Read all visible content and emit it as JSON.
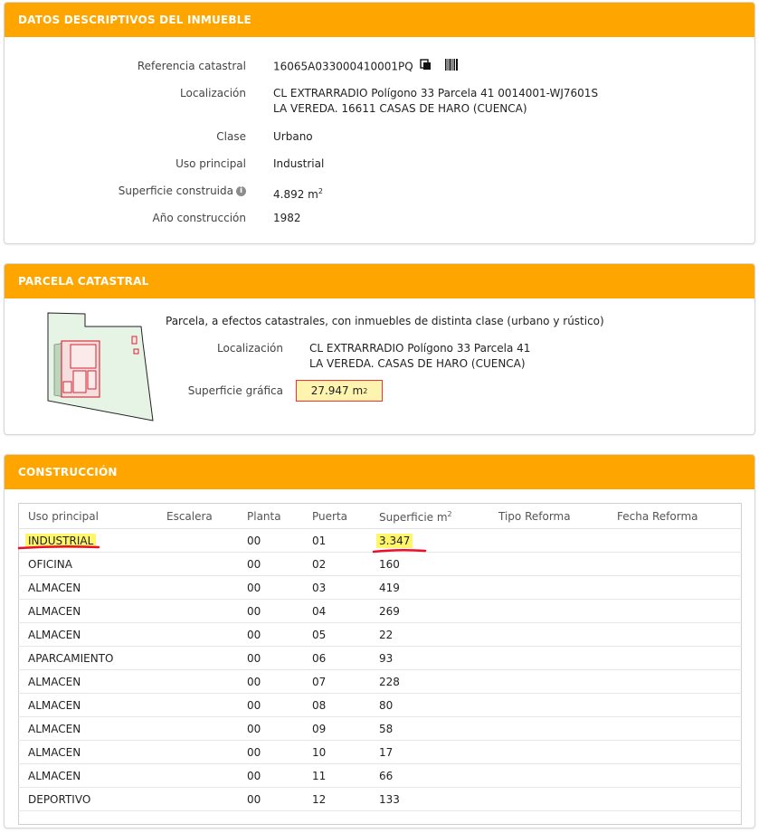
{
  "descriptivos": {
    "title": "DATOS DESCRIPTIVOS DEL INMUEBLE",
    "ref_label": "Referencia catastral",
    "ref_value": "16065A033000410001PQ",
    "loc_label": "Localización",
    "loc_line1": "CL EXTRARRADIO Polígono 33 Parcela 41 0014001-WJ7601S",
    "loc_line2": "LA VEREDA. 16611 CASAS DE HARO (CUENCA)",
    "clase_label": "Clase",
    "clase_value": "Urbano",
    "uso_label": "Uso principal",
    "uso_value": "Industrial",
    "sup_label": "Superficie construida",
    "sup_value": "4.892 m",
    "sup_unit_sup": "2",
    "anio_label": "Año construcción",
    "anio_value": "1982"
  },
  "parcela": {
    "title": "PARCELA CATASTRAL",
    "desc": "Parcela, a efectos catastrales, con inmuebles de distinta clase (urbano y rústico)",
    "loc_label": "Localización",
    "loc_line1": "CL EXTRARRADIO Polígono 33 Parcela 41",
    "loc_line2": "LA VEREDA. CASAS DE HARO (CUENCA)",
    "sup_label": "Superficie gráfica",
    "sup_value": "27.947 m",
    "sup_unit_sup": "2"
  },
  "construccion": {
    "title": "CONSTRUCCIÓN",
    "headers": [
      "Uso principal",
      "Escalera",
      "Planta",
      "Puerta",
      "Superficie m",
      "Tipo Reforma",
      "Fecha Reforma"
    ],
    "sup_header_sup": "2",
    "rows": [
      [
        "INDUSTRIAL",
        "",
        "00",
        "01",
        "3.347",
        "",
        ""
      ],
      [
        "OFICINA",
        "",
        "00",
        "02",
        "160",
        "",
        ""
      ],
      [
        "ALMACEN",
        "",
        "00",
        "03",
        "419",
        "",
        ""
      ],
      [
        "ALMACEN",
        "",
        "00",
        "04",
        "269",
        "",
        ""
      ],
      [
        "ALMACEN",
        "",
        "00",
        "05",
        "22",
        "",
        ""
      ],
      [
        "APARCAMIENTO",
        "",
        "00",
        "06",
        "93",
        "",
        ""
      ],
      [
        "ALMACEN",
        "",
        "00",
        "07",
        "228",
        "",
        ""
      ],
      [
        "ALMACEN",
        "",
        "00",
        "08",
        "80",
        "",
        ""
      ],
      [
        "ALMACEN",
        "",
        "00",
        "09",
        "58",
        "",
        ""
      ],
      [
        "ALMACEN",
        "",
        "00",
        "10",
        "17",
        "",
        ""
      ],
      [
        "ALMACEN",
        "",
        "00",
        "11",
        "66",
        "",
        ""
      ],
      [
        "DEPORTIVO",
        "",
        "00",
        "12",
        "133",
        "",
        ""
      ]
    ]
  },
  "icons": {
    "copy": "copy-icon",
    "barcode": "barcode-icon",
    "info": "info-icon"
  },
  "colors": {
    "header_orange": "#ffa500",
    "highlight_yellow": "#fff66b",
    "underline_red": "#e8102a"
  }
}
